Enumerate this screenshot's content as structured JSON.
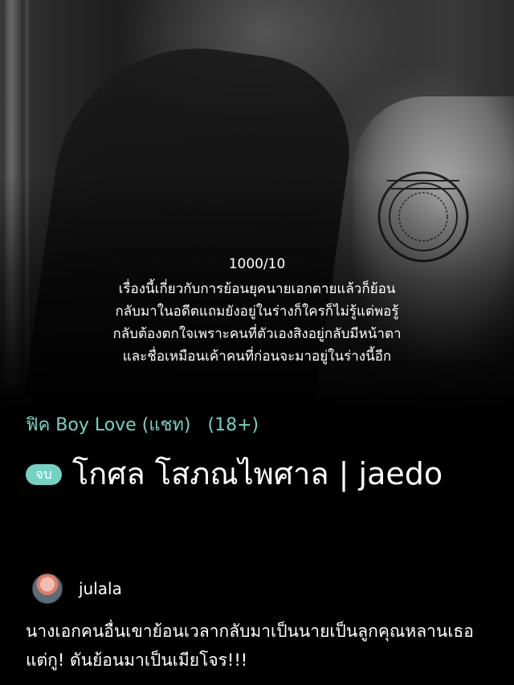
{
  "cover": {
    "read_count": "1000/10",
    "synopsis": "เรื่องนี้เกี่ยวกับการย้อนยุคนายเอกตายแล้วก็ย้อนกลับมาในอดีตแถมยังอยู่ในร่างก็ใครก็ไม่รู้แต่พอรู้กลับต้องตกใจเพราะคนที่ตัวเองสิงอยู่กลับมีหน้าตาและชื่อเหมือนเค้าคนที่ก่อนจะมาอยู่ในร่างนี้อีก",
    "image_icon": "cover-photo-icon"
  },
  "story": {
    "category": "ฟิค Boy Love (แชท)",
    "rating": "(18+)",
    "status_badge": "จบ",
    "title": "โกศล โสภณไพศาล | jaedo",
    "author": "julala",
    "description": "นางเอกคนอื่นเขาย้อนเวลากลับมาเป็นนายเป็นลูกคุณหลานเธอ แต่กู! ดันย้อนมาเป็นเมียโจร!!!"
  },
  "colors": {
    "accent": "#72d3c4",
    "background": "#000000",
    "text": "#ffffff"
  }
}
